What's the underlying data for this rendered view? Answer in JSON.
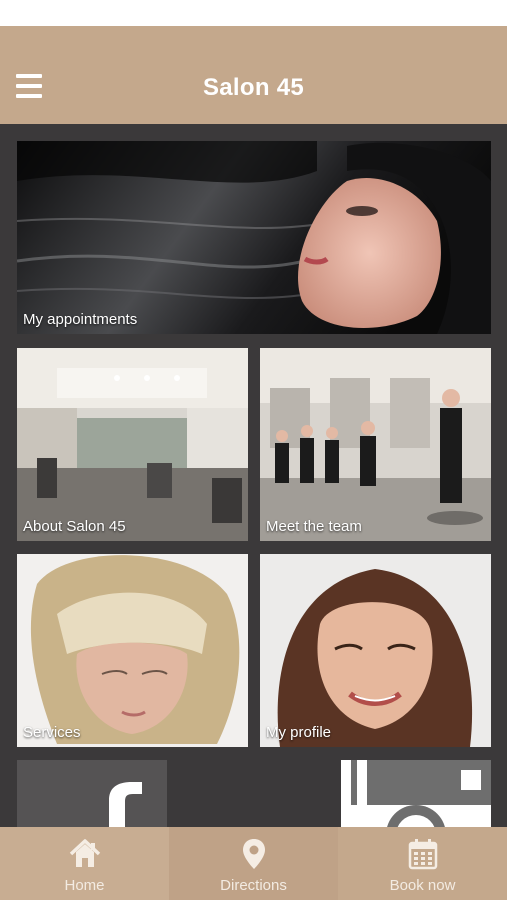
{
  "header": {
    "title": "Salon 45",
    "menu_icon": "hamburger-menu-icon",
    "background": "#c4a88c"
  },
  "tiles": [
    {
      "label": "My appointments"
    },
    {
      "label": "About Salon 45"
    },
    {
      "label": "Meet the team"
    },
    {
      "label": "Services"
    },
    {
      "label": "My profile"
    }
  ],
  "social_tiles": [
    {
      "icon": "facebook-icon"
    },
    {
      "icon": "instagram-icon"
    }
  ],
  "tab_bar": {
    "items": [
      {
        "label": "Home",
        "icon": "home-icon"
      },
      {
        "label": "Directions",
        "icon": "location-pin-icon"
      },
      {
        "label": "Book now",
        "icon": "calendar-icon"
      }
    ]
  },
  "colors": {
    "accent": "#c4a88c",
    "content_background": "#3b393a",
    "text_light": "#ffffff"
  }
}
